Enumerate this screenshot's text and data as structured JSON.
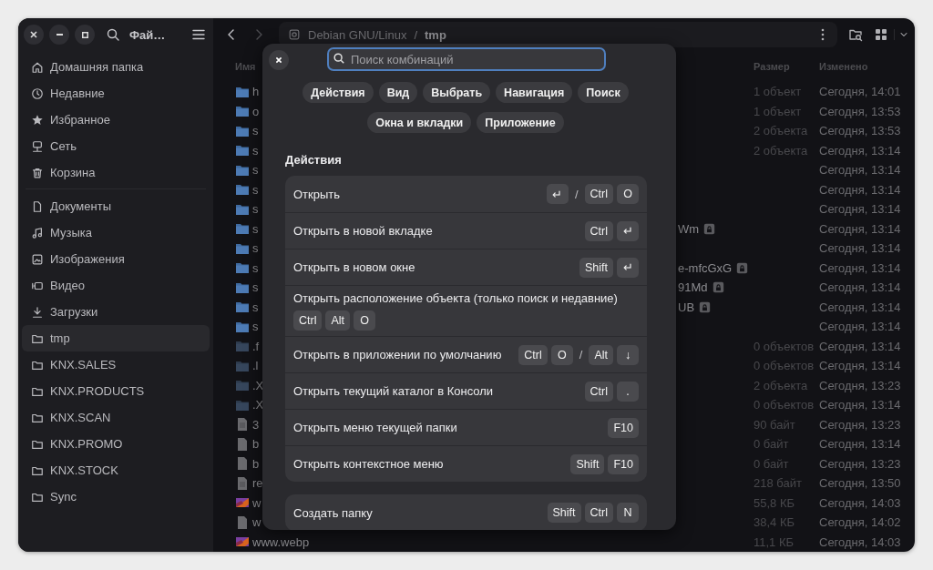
{
  "window": {
    "title": "Фай…"
  },
  "sidebar": {
    "places": [
      {
        "kind": "home",
        "label": "Домашняя папка",
        "selected": false
      },
      {
        "kind": "recent",
        "label": "Недавние",
        "selected": false
      },
      {
        "kind": "starred",
        "label": "Избранное",
        "selected": false
      },
      {
        "kind": "network",
        "label": "Сеть",
        "selected": false
      },
      {
        "kind": "trash",
        "label": "Корзина",
        "selected": false
      }
    ],
    "bookmarks": [
      {
        "kind": "documents",
        "label": "Документы",
        "selected": false
      },
      {
        "kind": "music",
        "label": "Музыка",
        "selected": false
      },
      {
        "kind": "pictures",
        "label": "Изображения",
        "selected": false
      },
      {
        "kind": "videos",
        "label": "Видео",
        "selected": false
      },
      {
        "kind": "downloads",
        "label": "Загрузки",
        "selected": false
      },
      {
        "kind": "folder",
        "label": "tmp",
        "selected": true
      },
      {
        "kind": "folder",
        "label": "KNX.SALES",
        "selected": false
      },
      {
        "kind": "folder",
        "label": "KNX.PRODUCTS",
        "selected": false
      },
      {
        "kind": "folder",
        "label": "KNX.SCAN",
        "selected": false
      },
      {
        "kind": "folder",
        "label": "KNX.PROMO",
        "selected": false
      },
      {
        "kind": "folder",
        "label": "KNX.STOCK",
        "selected": false
      },
      {
        "kind": "folder",
        "label": "Sync",
        "selected": false
      }
    ]
  },
  "path_bar": {
    "segments": [
      "Debian GNU/Linux",
      "tmp"
    ],
    "separator": "/"
  },
  "file_list": {
    "columns": [
      "Имя",
      "Размер",
      "Изменено"
    ],
    "rows": [
      {
        "kind": "folder",
        "name": "h",
        "size": "1 объект",
        "modified": "Сегодня, 14:01",
        "locked": false
      },
      {
        "kind": "folder",
        "name": "o",
        "size": "1 объект",
        "modified": "Сегодня, 13:53",
        "locked": false
      },
      {
        "kind": "folder",
        "name": "s",
        "size": "2 объекта",
        "modified": "Сегодня, 13:53",
        "locked": false
      },
      {
        "kind": "folder",
        "name": "s",
        "size": "2 объекта",
        "modified": "Сегодня, 13:14",
        "locked": false
      },
      {
        "kind": "folder",
        "name": "s",
        "modified": "Сегодня, 13:14",
        "locked": false
      },
      {
        "kind": "folder",
        "name": "s",
        "modified": "Сегодня, 13:14",
        "locked": false
      },
      {
        "kind": "folder",
        "name": "s",
        "modified": "Сегодня, 13:14",
        "locked": false
      },
      {
        "kind": "folder",
        "name": "s",
        "name_end": "Wm",
        "modified": "Сегодня, 13:14",
        "locked": true
      },
      {
        "kind": "folder",
        "name": "s",
        "modified": "Сегодня, 13:14",
        "locked": false
      },
      {
        "kind": "folder",
        "name": "s",
        "name_end": "e-mfcGxG",
        "modified": "Сегодня, 13:14",
        "locked": true
      },
      {
        "kind": "folder",
        "name": "s",
        "name_end": "91Md",
        "modified": "Сегодня, 13:14",
        "locked": true
      },
      {
        "kind": "folder",
        "name": "s",
        "name_end": "UB",
        "modified": "Сегодня, 13:14",
        "locked": true
      },
      {
        "kind": "folder",
        "name": "s",
        "modified": "Сегодня, 13:14",
        "locked": false
      },
      {
        "kind": "hidden-folder",
        "name": ".f",
        "size": "0 объектов",
        "modified": "Сегодня, 13:14",
        "locked": false
      },
      {
        "kind": "hidden-folder",
        "name": ".l",
        "size": "0 объектов",
        "modified": "Сегодня, 13:14",
        "locked": false
      },
      {
        "kind": "hidden-folder",
        "name": ".X",
        "size": "2 объекта",
        "modified": "Сегодня, 13:23",
        "locked": false
      },
      {
        "kind": "hidden-folder",
        "name": ".X",
        "size": "0 объектов",
        "modified": "Сегодня, 13:14",
        "locked": false
      },
      {
        "kind": "text-file",
        "name": "3",
        "size": "90 байт",
        "modified": "Сегодня, 13:23",
        "locked": false
      },
      {
        "kind": "file",
        "name": "b",
        "size": "0 байт",
        "modified": "Сегодня, 13:14",
        "locked": false
      },
      {
        "kind": "file",
        "name": "b",
        "size": "0 байт",
        "modified": "Сегодня, 13:23",
        "locked": false
      },
      {
        "kind": "text-file",
        "name": "re",
        "size": "218 байт",
        "modified": "Сегодня, 13:50",
        "locked": false
      },
      {
        "kind": "image",
        "name": "w",
        "size": "55,8 КБ",
        "modified": "Сегодня, 14:03",
        "locked": false
      },
      {
        "kind": "file",
        "name": "w",
        "size": "38,4 КБ",
        "modified": "Сегодня, 14:02",
        "locked": false
      },
      {
        "kind": "image",
        "name": "www.webp",
        "size": "11,1 КБ",
        "modified": "Сегодня, 14:03",
        "locked": false
      }
    ]
  },
  "shortcuts_dialog": {
    "search": {
      "placeholder": "Поиск комбинаций"
    },
    "categories": [
      "Действия",
      "Вид",
      "Выбрать",
      "Навигация",
      "Поиск",
      "Окна и вкладки",
      "Приложение"
    ],
    "sections": [
      {
        "title": "Действия",
        "groups": [
          {
            "items": [
              {
                "kind": "inline",
                "label": "Открыть",
                "keys": [
                  {
                    "kind": "key",
                    "label": "↵"
                  },
                  {
                    "kind": "sep",
                    "label": "/"
                  },
                  {
                    "kind": "key",
                    "label": "Ctrl"
                  },
                  {
                    "kind": "key",
                    "label": "O"
                  }
                ]
              },
              {
                "kind": "inline",
                "label": "Открыть в новой вкладке",
                "keys": [
                  {
                    "kind": "key",
                    "label": "Ctrl"
                  },
                  {
                    "kind": "key",
                    "label": "↵"
                  }
                ]
              },
              {
                "kind": "inline",
                "label": "Открыть в новом окне",
                "keys": [
                  {
                    "kind": "key",
                    "label": "Shift"
                  },
                  {
                    "kind": "key",
                    "label": "↵"
                  }
                ]
              },
              {
                "kind": "stacked",
                "label": "Открыть расположение объекта (только поиск и недавние)",
                "keys": [
                  {
                    "kind": "key",
                    "label": "Ctrl"
                  },
                  {
                    "kind": "key",
                    "label": "Alt"
                  },
                  {
                    "kind": "key",
                    "label": "O"
                  }
                ]
              },
              {
                "kind": "inline",
                "label": "Открыть в приложении по умолчанию",
                "keys": [
                  {
                    "kind": "key",
                    "label": "Ctrl"
                  },
                  {
                    "kind": "key",
                    "label": "O"
                  },
                  {
                    "kind": "sep",
                    "label": "/"
                  },
                  {
                    "kind": "key",
                    "label": "Alt"
                  },
                  {
                    "kind": "key",
                    "label": "↓"
                  }
                ]
              },
              {
                "kind": "inline",
                "label": "Открыть текущий каталог в Консоли",
                "keys": [
                  {
                    "kind": "key",
                    "label": "Ctrl"
                  },
                  {
                    "kind": "key",
                    "label": "."
                  }
                ]
              },
              {
                "kind": "inline",
                "label": "Открыть меню текущей папки",
                "keys": [
                  {
                    "kind": "key",
                    "label": "F10"
                  }
                ]
              },
              {
                "kind": "inline",
                "label": "Открыть контекстное меню",
                "keys": [
                  {
                    "kind": "key",
                    "label": "Shift"
                  },
                  {
                    "kind": "key",
                    "label": "F10"
                  }
                ]
              }
            ]
          },
          {
            "items": [
              {
                "kind": "inline",
                "label": "Создать папку",
                "keys": [
                  {
                    "kind": "key",
                    "label": "Shift"
                  },
                  {
                    "kind": "key",
                    "label": "Ctrl"
                  },
                  {
                    "kind": "key",
                    "label": "N"
                  }
                ]
              }
            ]
          }
        ]
      }
    ]
  }
}
